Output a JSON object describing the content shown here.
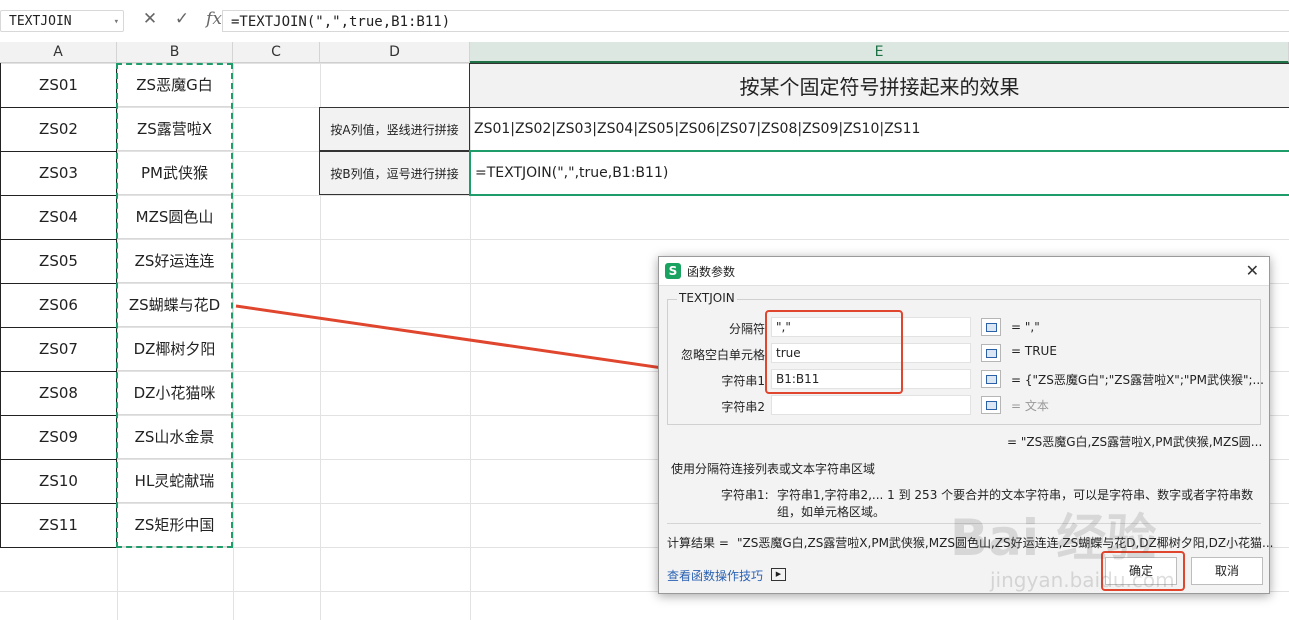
{
  "formula_bar": {
    "name_box": "TEXTJOIN",
    "cancel_icon": "close-icon",
    "enter_icon": "check-icon",
    "fx_label": "fx",
    "formula": "=TEXTJOIN(\",\",true,B1:B11)"
  },
  "columns": [
    "A",
    "B",
    "C",
    "D",
    "E"
  ],
  "col_a": [
    "ZS01",
    "ZS02",
    "ZS03",
    "ZS04",
    "ZS05",
    "ZS06",
    "ZS07",
    "ZS08",
    "ZS09",
    "ZS10",
    "ZS11"
  ],
  "col_b": [
    "ZS恶魔G白",
    "ZS露营啦X",
    "PM武侠猴",
    "MZS圆色山",
    "ZS好运连连",
    "ZS蝴蝶与花D",
    "DZ椰树夕阳",
    "DZ小花猫咪",
    "ZS山水金景",
    "HL灵蛇献瑞",
    "ZS矩形中国"
  ],
  "sheet": {
    "title": "按某个固定符号拼接起来的效果",
    "row2_label": "按A列值，竖线进行拼接",
    "row2_value": "ZS01|ZS02|ZS03|ZS04|ZS05|ZS06|ZS07|ZS08|ZS09|ZS10|ZS11",
    "row3_label": "按B列值，逗号进行拼接",
    "row3_value": "=TEXTJOIN(\",\",true,B1:B11)"
  },
  "dialog": {
    "title": "函数参数",
    "group_label": "TEXTJOIN",
    "params": [
      {
        "label": "分隔符",
        "value": "\",\"",
        "result": "= \",\""
      },
      {
        "label": "忽略空白单元格",
        "value": "true",
        "result": "= TRUE"
      },
      {
        "label": "字符串1",
        "value": "B1:B11",
        "result": "= {\"ZS恶魔G白\";\"ZS露营啦X\";\"PM武侠猴\";..."
      },
      {
        "label": "字符串2",
        "value": "",
        "result": "= 文本"
      }
    ],
    "overall_result": "= \"ZS恶魔G白,ZS露营啦X,PM武侠猴,MZS圆...",
    "description": "使用分隔符连接列表或文本字符串区域",
    "arg_name": "字符串1:",
    "arg_desc_1": "字符串1,字符串2,... 1 到 253 个要合并的文本字符串，可以是字符串、数字或者字符串数",
    "arg_desc_2": "组，如单元格区域。",
    "calc_label": "计算结果 =",
    "calc_value": "\"ZS恶魔G白,ZS露营啦X,PM武侠猴,MZS圆色山,ZS好运连连,ZS蝴蝶与花D,DZ椰树夕阳,DZ小花猫...",
    "help_link": "查看函数操作技巧",
    "ok": "确定",
    "cancel": "取消"
  },
  "watermark": {
    "main": "Bai 经验",
    "sub": "jingyan.baidu.com"
  },
  "colors": {
    "accent_green": "#1e9c6a",
    "highlight_red": "#e0452e",
    "logo_green": "#1aa260"
  }
}
